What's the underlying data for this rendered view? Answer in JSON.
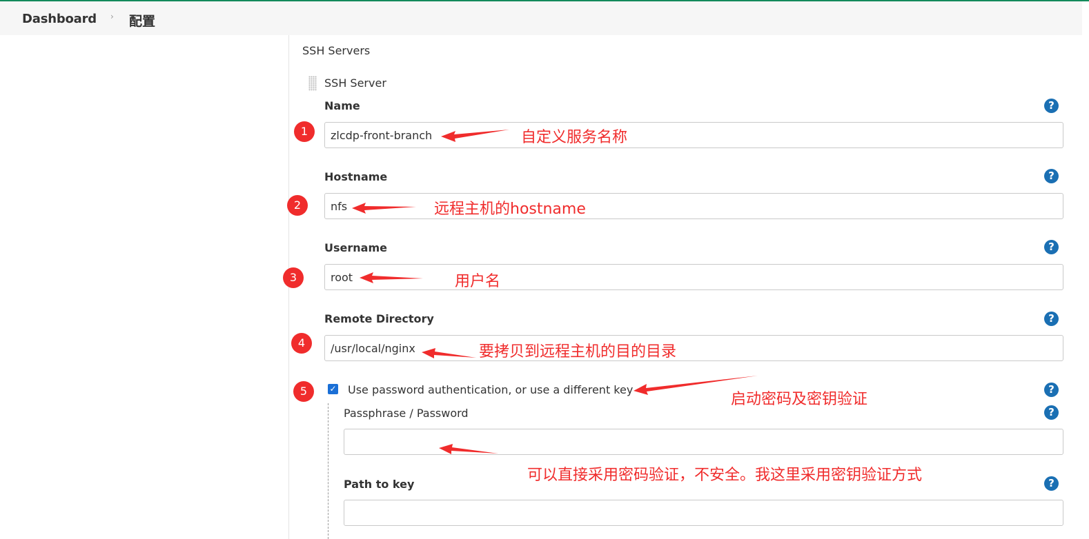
{
  "breadcrumb": {
    "dashboard": "Dashboard",
    "separator": "›",
    "current": "配置"
  },
  "section": {
    "title": "SSH Servers",
    "subtitle": "SSH Server"
  },
  "fields": {
    "name": {
      "label": "Name",
      "value": "zlcdp-front-branch"
    },
    "hostname": {
      "label": "Hostname",
      "value": "nfs"
    },
    "username": {
      "label": "Username",
      "value": "root"
    },
    "remote_directory": {
      "label": "Remote Directory",
      "value": "/usr/local/nginx"
    },
    "use_password": {
      "label": "Use password authentication, or use a different key",
      "checked": true
    },
    "passphrase": {
      "label": "Passphrase / Password",
      "value": ""
    },
    "path_to_key": {
      "label": "Path to key",
      "value": ""
    }
  },
  "help_glyph": "?",
  "check_glyph": "✓",
  "annotations": {
    "markers": [
      "1",
      "2",
      "3",
      "4",
      "5"
    ],
    "notes": {
      "name": "自定义服务名称",
      "hostname": "远程主机的hostname",
      "username": "用户名",
      "remote_directory": "要拷贝到远程主机的目的目录",
      "use_password": "启动密码及密钥验证",
      "passphrase": "可以直接采用密码验证，不安全。我这里采用密钥验证方式"
    }
  },
  "colors": {
    "annotation": "#f02c2c",
    "help_icon": "#1a6fb3",
    "checkbox": "#1a6fd6",
    "top_accent": "#138a5b"
  }
}
